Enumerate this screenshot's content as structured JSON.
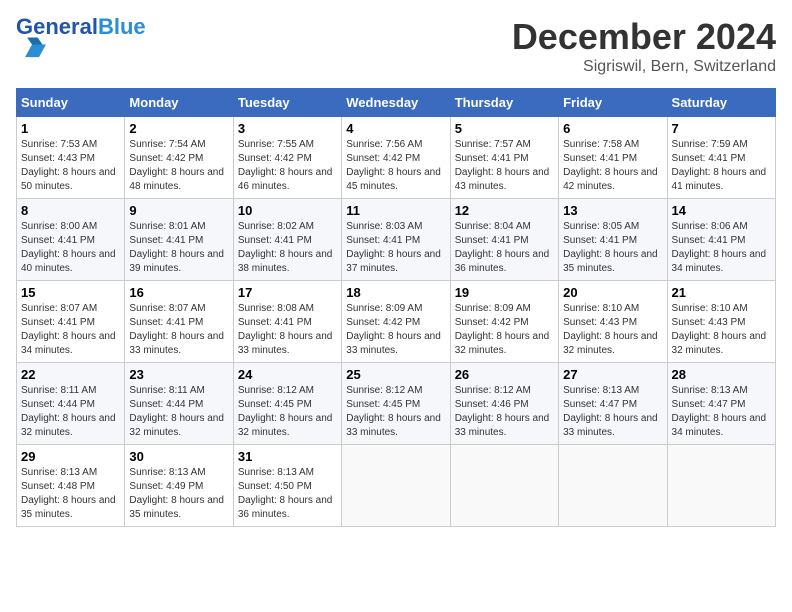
{
  "header": {
    "logo_text_general": "General",
    "logo_text_blue": "Blue",
    "main_title": "December 2024",
    "subtitle": "Sigriswil, Bern, Switzerland"
  },
  "days_of_week": [
    "Sunday",
    "Monday",
    "Tuesday",
    "Wednesday",
    "Thursday",
    "Friday",
    "Saturday"
  ],
  "weeks": [
    [
      {
        "day": "1",
        "sunrise": "Sunrise: 7:53 AM",
        "sunset": "Sunset: 4:43 PM",
        "daylight": "Daylight: 8 hours and 50 minutes."
      },
      {
        "day": "2",
        "sunrise": "Sunrise: 7:54 AM",
        "sunset": "Sunset: 4:42 PM",
        "daylight": "Daylight: 8 hours and 48 minutes."
      },
      {
        "day": "3",
        "sunrise": "Sunrise: 7:55 AM",
        "sunset": "Sunset: 4:42 PM",
        "daylight": "Daylight: 8 hours and 46 minutes."
      },
      {
        "day": "4",
        "sunrise": "Sunrise: 7:56 AM",
        "sunset": "Sunset: 4:42 PM",
        "daylight": "Daylight: 8 hours and 45 minutes."
      },
      {
        "day": "5",
        "sunrise": "Sunrise: 7:57 AM",
        "sunset": "Sunset: 4:41 PM",
        "daylight": "Daylight: 8 hours and 43 minutes."
      },
      {
        "day": "6",
        "sunrise": "Sunrise: 7:58 AM",
        "sunset": "Sunset: 4:41 PM",
        "daylight": "Daylight: 8 hours and 42 minutes."
      },
      {
        "day": "7",
        "sunrise": "Sunrise: 7:59 AM",
        "sunset": "Sunset: 4:41 PM",
        "daylight": "Daylight: 8 hours and 41 minutes."
      }
    ],
    [
      {
        "day": "8",
        "sunrise": "Sunrise: 8:00 AM",
        "sunset": "Sunset: 4:41 PM",
        "daylight": "Daylight: 8 hours and 40 minutes."
      },
      {
        "day": "9",
        "sunrise": "Sunrise: 8:01 AM",
        "sunset": "Sunset: 4:41 PM",
        "daylight": "Daylight: 8 hours and 39 minutes."
      },
      {
        "day": "10",
        "sunrise": "Sunrise: 8:02 AM",
        "sunset": "Sunset: 4:41 PM",
        "daylight": "Daylight: 8 hours and 38 minutes."
      },
      {
        "day": "11",
        "sunrise": "Sunrise: 8:03 AM",
        "sunset": "Sunset: 4:41 PM",
        "daylight": "Daylight: 8 hours and 37 minutes."
      },
      {
        "day": "12",
        "sunrise": "Sunrise: 8:04 AM",
        "sunset": "Sunset: 4:41 PM",
        "daylight": "Daylight: 8 hours and 36 minutes."
      },
      {
        "day": "13",
        "sunrise": "Sunrise: 8:05 AM",
        "sunset": "Sunset: 4:41 PM",
        "daylight": "Daylight: 8 hours and 35 minutes."
      },
      {
        "day": "14",
        "sunrise": "Sunrise: 8:06 AM",
        "sunset": "Sunset: 4:41 PM",
        "daylight": "Daylight: 8 hours and 34 minutes."
      }
    ],
    [
      {
        "day": "15",
        "sunrise": "Sunrise: 8:07 AM",
        "sunset": "Sunset: 4:41 PM",
        "daylight": "Daylight: 8 hours and 34 minutes."
      },
      {
        "day": "16",
        "sunrise": "Sunrise: 8:07 AM",
        "sunset": "Sunset: 4:41 PM",
        "daylight": "Daylight: 8 hours and 33 minutes."
      },
      {
        "day": "17",
        "sunrise": "Sunrise: 8:08 AM",
        "sunset": "Sunset: 4:41 PM",
        "daylight": "Daylight: 8 hours and 33 minutes."
      },
      {
        "day": "18",
        "sunrise": "Sunrise: 8:09 AM",
        "sunset": "Sunset: 4:42 PM",
        "daylight": "Daylight: 8 hours and 33 minutes."
      },
      {
        "day": "19",
        "sunrise": "Sunrise: 8:09 AM",
        "sunset": "Sunset: 4:42 PM",
        "daylight": "Daylight: 8 hours and 32 minutes."
      },
      {
        "day": "20",
        "sunrise": "Sunrise: 8:10 AM",
        "sunset": "Sunset: 4:43 PM",
        "daylight": "Daylight: 8 hours and 32 minutes."
      },
      {
        "day": "21",
        "sunrise": "Sunrise: 8:10 AM",
        "sunset": "Sunset: 4:43 PM",
        "daylight": "Daylight: 8 hours and 32 minutes."
      }
    ],
    [
      {
        "day": "22",
        "sunrise": "Sunrise: 8:11 AM",
        "sunset": "Sunset: 4:44 PM",
        "daylight": "Daylight: 8 hours and 32 minutes."
      },
      {
        "day": "23",
        "sunrise": "Sunrise: 8:11 AM",
        "sunset": "Sunset: 4:44 PM",
        "daylight": "Daylight: 8 hours and 32 minutes."
      },
      {
        "day": "24",
        "sunrise": "Sunrise: 8:12 AM",
        "sunset": "Sunset: 4:45 PM",
        "daylight": "Daylight: 8 hours and 32 minutes."
      },
      {
        "day": "25",
        "sunrise": "Sunrise: 8:12 AM",
        "sunset": "Sunset: 4:45 PM",
        "daylight": "Daylight: 8 hours and 33 minutes."
      },
      {
        "day": "26",
        "sunrise": "Sunrise: 8:12 AM",
        "sunset": "Sunset: 4:46 PM",
        "daylight": "Daylight: 8 hours and 33 minutes."
      },
      {
        "day": "27",
        "sunrise": "Sunrise: 8:13 AM",
        "sunset": "Sunset: 4:47 PM",
        "daylight": "Daylight: 8 hours and 33 minutes."
      },
      {
        "day": "28",
        "sunrise": "Sunrise: 8:13 AM",
        "sunset": "Sunset: 4:47 PM",
        "daylight": "Daylight: 8 hours and 34 minutes."
      }
    ],
    [
      {
        "day": "29",
        "sunrise": "Sunrise: 8:13 AM",
        "sunset": "Sunset: 4:48 PM",
        "daylight": "Daylight: 8 hours and 35 minutes."
      },
      {
        "day": "30",
        "sunrise": "Sunrise: 8:13 AM",
        "sunset": "Sunset: 4:49 PM",
        "daylight": "Daylight: 8 hours and 35 minutes."
      },
      {
        "day": "31",
        "sunrise": "Sunrise: 8:13 AM",
        "sunset": "Sunset: 4:50 PM",
        "daylight": "Daylight: 8 hours and 36 minutes."
      },
      null,
      null,
      null,
      null
    ]
  ]
}
